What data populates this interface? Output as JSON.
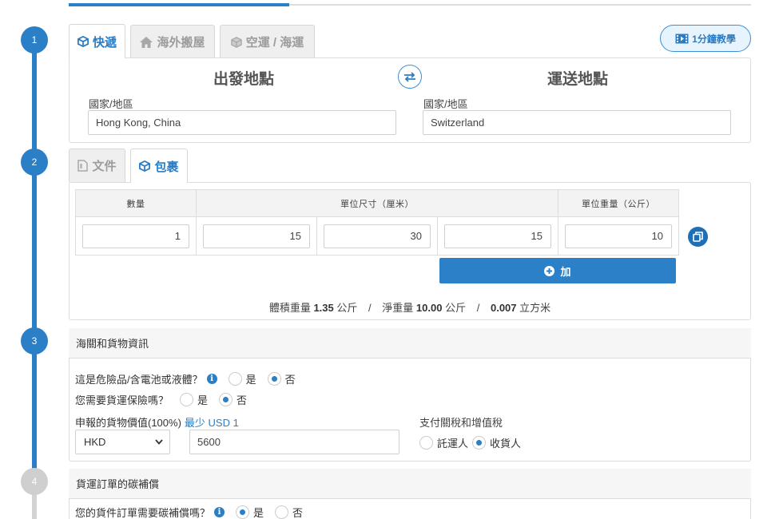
{
  "step1": {
    "number": "1",
    "tabs": [
      {
        "label": "快遞"
      },
      {
        "label": "海外搬屋"
      },
      {
        "label": "空運 / 海運"
      }
    ],
    "tutorial_label": "1分鐘教學",
    "origin_title": "出發地點",
    "destination_title": "運送地點",
    "country_label": "國家/地區",
    "origin_value": "Hong Kong, China",
    "destination_value": "Switzerland"
  },
  "step2": {
    "number": "2",
    "tabs": [
      {
        "label": "文件"
      },
      {
        "label": "包裹"
      }
    ],
    "headers": {
      "quantity": "數量",
      "dimensions": "單位尺寸（厘米）",
      "weight": "單位重量（公斤）"
    },
    "row": {
      "quantity": "1",
      "length": "15",
      "width": "30",
      "height": "15",
      "weight": "10"
    },
    "add_label": "加",
    "summary": {
      "volumetric_label": "體積重量",
      "volumetric_value": "1.35",
      "net_label": "淨重量",
      "net_value": "10.00",
      "kg_unit": "公斤",
      "volume_value": "0.007",
      "volume_unit": "立方米",
      "separator": "/"
    }
  },
  "step3": {
    "number": "3",
    "title": "海關和貨物資訊",
    "dangerous_question": "這是危險品/含電池或液體？",
    "insurance_question": "您需要貨運保險嗎？",
    "yes": "是",
    "no": "否",
    "declared_label": "申報的貨物價值(100%)",
    "minimum_label": "最少 USD 1",
    "currency": "HKD",
    "declared_value": "5600",
    "duties_label": "支付關稅和增值稅",
    "shipper": "託運人",
    "receiver": "收貨人"
  },
  "step4": {
    "number": "4",
    "title": "貨運訂單的碳補償",
    "carbon_question": "您的貨件訂單需要碳補償嗎？",
    "yes": "是",
    "no": "否"
  },
  "colors": {
    "accent": "#2a7fc6",
    "inactive_step": "#cfcfcf"
  },
  "icons": {
    "express": "cube-icon",
    "moving": "home-icon",
    "freight": "box-icon",
    "document": "document-icon",
    "package": "cube-icon",
    "tutorial": "film-icon",
    "swap": "swap-arrows-icon",
    "copy": "copy-icon",
    "add": "plus-circle-icon",
    "info": "info-icon",
    "dropdown": "chevron-down-icon"
  }
}
